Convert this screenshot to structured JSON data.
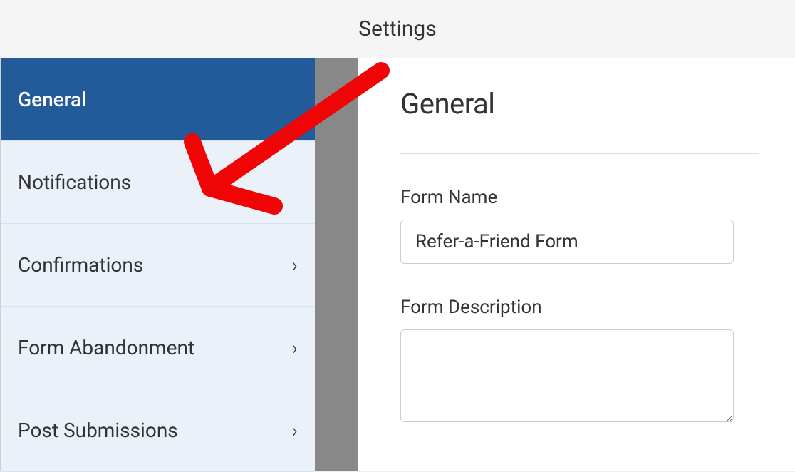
{
  "header": {
    "title": "Settings"
  },
  "sidebar": {
    "items": [
      {
        "label": "General",
        "has_chevron": false,
        "active": true
      },
      {
        "label": "Notifications",
        "has_chevron": false,
        "active": false
      },
      {
        "label": "Confirmations",
        "has_chevron": true,
        "active": false
      },
      {
        "label": "Form Abandonment",
        "has_chevron": true,
        "active": false
      },
      {
        "label": "Post Submissions",
        "has_chevron": true,
        "active": false
      }
    ]
  },
  "content": {
    "title": "General",
    "form_name_label": "Form Name",
    "form_name_value": "Refer-a-Friend Form",
    "form_description_label": "Form Description",
    "form_description_value": ""
  },
  "annotation": {
    "color": "#ef0505"
  }
}
